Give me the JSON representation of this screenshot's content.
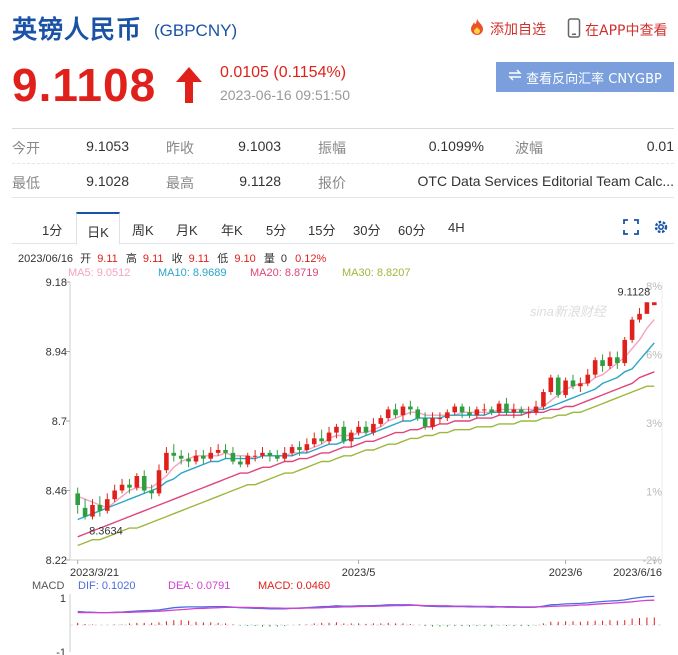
{
  "header": {
    "title": "英镑人民币",
    "code": "(GBPCNY)",
    "add_favorite": "添加自选",
    "view_in_app": "在APP中查看"
  },
  "quote": {
    "price": "9.1108",
    "change": "0.0105 (0.1154%)",
    "time": "2023-06-16 09:51:50",
    "reverse_button": "查看反向汇率 CNYGBP",
    "up_color": "#e0211b"
  },
  "stats": {
    "rows": [
      [
        {
          "label": "今开",
          "value": "9.1053"
        },
        {
          "label": "昨收",
          "value": "9.1003"
        },
        {
          "label": "振幅",
          "value": "0.1099%"
        },
        {
          "label": "波幅",
          "value": "0.01"
        }
      ],
      [
        {
          "label": "最低",
          "value": "9.1028"
        },
        {
          "label": "最高",
          "value": "9.1128"
        },
        {
          "label": "报价",
          "value": "OTC Data Services Editorial Team Calc..."
        }
      ]
    ]
  },
  "tabs": [
    "1分",
    "日K",
    "周K",
    "月K",
    "年K",
    "5分",
    "15分",
    "30分",
    "60分",
    "4H"
  ],
  "active_tab": "日K",
  "icons": [
    "fullscreen-icon",
    "settings-icon",
    "fire-icon",
    "phone-icon",
    "arrow-up-icon",
    "exchange-icon"
  ],
  "info_line": {
    "date": "2023/06/16",
    "open_label": "开",
    "open": "9.11",
    "high_label": "高",
    "high": "9.11",
    "close_label": "收",
    "close": "9.11",
    "low_label": "低",
    "low": "9.10",
    "vol_label": "量",
    "vol": "0",
    "pct": "0.12%"
  },
  "ma_legend": [
    {
      "text": "MA5: 9.0512",
      "color": "#f4a3c0"
    },
    {
      "text": "MA10: 8.9689",
      "color": "#2ba6c9"
    },
    {
      "text": "MA20: 8.8719",
      "color": "#e0447c"
    },
    {
      "text": "MA30: 8.8207",
      "color": "#9cb83c"
    }
  ],
  "macd_legend": {
    "label": "MACD",
    "dif": "DIF: 0.1020",
    "dea": "DEA: 0.0791",
    "macd": "MACD: 0.0460"
  },
  "watermark": "sina新浪财经",
  "chart_data": {
    "type": "candlestick",
    "y_ticks": [
      "9.18",
      "8.94",
      "8.7",
      "8.46",
      "8.22"
    ],
    "y_range": [
      8.22,
      9.18
    ],
    "pct_ticks": [
      "8%",
      "6%",
      "3%",
      "1%",
      "-2%"
    ],
    "x_ticks": [
      "2023/3/21",
      "2023/5",
      "2023/6",
      "2023/6/16"
    ],
    "max_label": "9.1128",
    "min_label": "8.3634",
    "macd_ticks": [
      "1",
      "-1"
    ],
    "candles": [
      [
        8.45,
        8.41,
        8.47,
        8.38
      ],
      [
        8.4,
        8.37,
        8.43,
        8.36
      ],
      [
        8.37,
        8.41,
        8.43,
        8.36
      ],
      [
        8.41,
        8.39,
        8.44,
        8.37
      ],
      [
        8.39,
        8.43,
        8.45,
        8.38
      ],
      [
        8.43,
        8.46,
        8.48,
        8.42
      ],
      [
        8.46,
        8.48,
        8.5,
        8.45
      ],
      [
        8.48,
        8.47,
        8.5,
        8.45
      ],
      [
        8.47,
        8.51,
        8.52,
        8.46
      ],
      [
        8.51,
        8.46,
        8.53,
        8.45
      ],
      [
        8.46,
        8.45,
        8.48,
        8.43
      ],
      [
        8.45,
        8.53,
        8.55,
        8.44
      ],
      [
        8.53,
        8.59,
        8.61,
        8.52
      ],
      [
        8.59,
        8.58,
        8.62,
        8.56
      ],
      [
        8.58,
        8.57,
        8.6,
        8.55
      ],
      [
        8.57,
        8.56,
        8.59,
        8.54
      ],
      [
        8.56,
        8.58,
        8.6,
        8.55
      ],
      [
        8.58,
        8.57,
        8.6,
        8.55
      ],
      [
        8.57,
        8.59,
        8.61,
        8.56
      ],
      [
        8.59,
        8.6,
        8.62,
        8.58
      ],
      [
        8.6,
        8.59,
        8.62,
        8.57
      ],
      [
        8.59,
        8.56,
        8.61,
        8.55
      ],
      [
        8.56,
        8.55,
        8.58,
        8.54
      ],
      [
        8.55,
        8.58,
        8.59,
        8.54
      ],
      [
        8.58,
        8.58,
        8.6,
        8.56
      ],
      [
        8.58,
        8.59,
        8.61,
        8.57
      ],
      [
        8.59,
        8.58,
        8.6,
        8.56
      ],
      [
        8.58,
        8.57,
        8.6,
        8.56
      ],
      [
        8.57,
        8.59,
        8.61,
        8.56
      ],
      [
        8.59,
        8.61,
        8.62,
        8.58
      ],
      [
        8.61,
        8.6,
        8.63,
        8.58
      ],
      [
        8.6,
        8.62,
        8.64,
        8.59
      ],
      [
        8.62,
        8.64,
        8.66,
        8.61
      ],
      [
        8.64,
        8.63,
        8.67,
        8.62
      ],
      [
        8.63,
        8.66,
        8.68,
        8.62
      ],
      [
        8.66,
        8.68,
        8.69,
        8.64
      ],
      [
        8.68,
        8.63,
        8.7,
        8.62
      ],
      [
        8.63,
        8.66,
        8.67,
        8.61
      ],
      [
        8.66,
        8.68,
        8.7,
        8.65
      ],
      [
        8.68,
        8.66,
        8.7,
        8.65
      ],
      [
        8.66,
        8.69,
        8.71,
        8.65
      ],
      [
        8.69,
        8.71,
        8.72,
        8.68
      ],
      [
        8.71,
        8.74,
        8.75,
        8.7
      ],
      [
        8.74,
        8.72,
        8.76,
        8.71
      ],
      [
        8.72,
        8.75,
        8.76,
        8.7
      ],
      [
        8.75,
        8.74,
        8.77,
        8.72
      ],
      [
        8.74,
        8.71,
        8.75,
        8.7
      ],
      [
        8.71,
        8.68,
        8.73,
        8.67
      ],
      [
        8.68,
        8.71,
        8.73,
        8.67
      ],
      [
        8.71,
        8.71,
        8.73,
        8.69
      ],
      [
        8.71,
        8.73,
        8.74,
        8.7
      ],
      [
        8.73,
        8.75,
        8.76,
        8.72
      ],
      [
        8.75,
        8.73,
        8.76,
        8.71
      ],
      [
        8.73,
        8.72,
        8.75,
        8.71
      ],
      [
        8.72,
        8.74,
        8.75,
        8.71
      ],
      [
        8.74,
        8.74,
        8.76,
        8.72
      ],
      [
        8.74,
        8.73,
        8.75,
        8.72
      ],
      [
        8.73,
        8.76,
        8.77,
        8.72
      ],
      [
        8.76,
        8.73,
        8.78,
        8.72
      ],
      [
        8.73,
        8.74,
        8.76,
        8.71
      ],
      [
        8.74,
        8.73,
        8.75,
        8.72
      ],
      [
        8.73,
        8.73,
        8.75,
        8.71
      ],
      [
        8.73,
        8.75,
        8.77,
        8.72
      ],
      [
        8.75,
        8.8,
        8.81,
        8.74
      ],
      [
        8.8,
        8.85,
        8.86,
        8.79
      ],
      [
        8.85,
        8.79,
        8.86,
        8.78
      ],
      [
        8.79,
        8.84,
        8.85,
        8.78
      ],
      [
        8.84,
        8.82,
        8.86,
        8.81
      ],
      [
        8.82,
        8.83,
        8.85,
        8.8
      ],
      [
        8.83,
        8.86,
        8.88,
        8.82
      ],
      [
        8.86,
        8.91,
        8.92,
        8.85
      ],
      [
        8.91,
        8.89,
        8.93,
        8.87
      ],
      [
        8.89,
        8.92,
        8.94,
        8.88
      ],
      [
        8.92,
        8.9,
        8.94,
        8.88
      ],
      [
        8.9,
        8.98,
        8.99,
        8.89
      ],
      [
        8.98,
        9.05,
        9.06,
        8.97
      ],
      [
        9.05,
        9.07,
        9.09,
        9.04
      ],
      [
        9.07,
        9.11,
        9.11,
        9.07
      ],
      [
        9.1,
        9.11,
        9.11,
        9.1
      ]
    ],
    "ma": [
      {
        "name": "MA5",
        "color": "#f4a3c0",
        "values": [
          8.44,
          8.43,
          8.42,
          8.41,
          8.4,
          8.42,
          8.44,
          8.46,
          8.47,
          8.47,
          8.47,
          8.49,
          8.51,
          8.54,
          8.56,
          8.57,
          8.58,
          8.58,
          8.58,
          8.58,
          8.59,
          8.58,
          8.58,
          8.58,
          8.57,
          8.58,
          8.58,
          8.58,
          8.58,
          8.59,
          8.59,
          8.6,
          8.61,
          8.62,
          8.64,
          8.65,
          8.65,
          8.65,
          8.66,
          8.66,
          8.67,
          8.68,
          8.7,
          8.71,
          8.72,
          8.73,
          8.73,
          8.72,
          8.72,
          8.72,
          8.72,
          8.72,
          8.73,
          8.73,
          8.73,
          8.73,
          8.73,
          8.74,
          8.74,
          8.74,
          8.74,
          8.74,
          8.74,
          8.75,
          8.77,
          8.79,
          8.81,
          8.82,
          8.83,
          8.83,
          8.85,
          8.86,
          8.88,
          8.9,
          8.92,
          8.95,
          8.98,
          9.02,
          9.05
        ]
      },
      {
        "name": "MA10",
        "color": "#2ba6c9",
        "values": [
          8.36,
          8.37,
          8.38,
          8.39,
          8.4,
          8.41,
          8.42,
          8.43,
          8.44,
          8.45,
          8.46,
          8.47,
          8.49,
          8.5,
          8.52,
          8.53,
          8.54,
          8.55,
          8.56,
          8.56,
          8.57,
          8.57,
          8.57,
          8.57,
          8.57,
          8.58,
          8.58,
          8.58,
          8.58,
          8.58,
          8.59,
          8.59,
          8.6,
          8.61,
          8.62,
          8.62,
          8.63,
          8.64,
          8.64,
          8.65,
          8.66,
          8.67,
          8.68,
          8.69,
          8.7,
          8.7,
          8.71,
          8.71,
          8.71,
          8.71,
          8.72,
          8.72,
          8.72,
          8.72,
          8.72,
          8.72,
          8.73,
          8.73,
          8.73,
          8.73,
          8.73,
          8.73,
          8.74,
          8.74,
          8.75,
          8.76,
          8.77,
          8.78,
          8.79,
          8.8,
          8.81,
          8.83,
          8.84,
          8.85,
          8.87,
          8.88,
          8.91,
          8.94,
          8.97
        ]
      },
      {
        "name": "MA20",
        "color": "#e0447c",
        "values": [
          8.3,
          8.31,
          8.32,
          8.33,
          8.34,
          8.35,
          8.36,
          8.37,
          8.38,
          8.39,
          8.4,
          8.41,
          8.42,
          8.43,
          8.44,
          8.45,
          8.46,
          8.47,
          8.48,
          8.49,
          8.5,
          8.51,
          8.52,
          8.52,
          8.53,
          8.54,
          8.54,
          8.55,
          8.56,
          8.56,
          8.57,
          8.57,
          8.58,
          8.59,
          8.59,
          8.6,
          8.61,
          8.61,
          8.62,
          8.63,
          8.63,
          8.64,
          8.65,
          8.66,
          8.66,
          8.67,
          8.67,
          8.68,
          8.68,
          8.69,
          8.69,
          8.7,
          8.7,
          8.7,
          8.71,
          8.71,
          8.71,
          8.72,
          8.72,
          8.72,
          8.72,
          8.73,
          8.73,
          8.73,
          8.74,
          8.74,
          8.75,
          8.75,
          8.76,
          8.77,
          8.78,
          8.79,
          8.8,
          8.81,
          8.82,
          8.83,
          8.85,
          8.86,
          8.87
        ]
      },
      {
        "name": "MA30",
        "color": "#9cb83c",
        "values": [
          8.27,
          8.28,
          8.29,
          8.29,
          8.3,
          8.31,
          8.32,
          8.33,
          8.33,
          8.34,
          8.35,
          8.36,
          8.37,
          8.38,
          8.39,
          8.4,
          8.41,
          8.42,
          8.43,
          8.44,
          8.45,
          8.46,
          8.47,
          8.48,
          8.48,
          8.49,
          8.5,
          8.51,
          8.52,
          8.52,
          8.53,
          8.54,
          8.55,
          8.56,
          8.56,
          8.57,
          8.58,
          8.58,
          8.59,
          8.6,
          8.6,
          8.61,
          8.62,
          8.62,
          8.63,
          8.64,
          8.64,
          8.65,
          8.65,
          8.66,
          8.66,
          8.67,
          8.67,
          8.67,
          8.68,
          8.68,
          8.68,
          8.69,
          8.69,
          8.69,
          8.7,
          8.7,
          8.7,
          8.71,
          8.71,
          8.72,
          8.72,
          8.73,
          8.73,
          8.74,
          8.75,
          8.76,
          8.77,
          8.78,
          8.79,
          8.8,
          8.81,
          8.82,
          8.82
        ]
      }
    ],
    "macd_range": [
      -1,
      1
    ],
    "dif": [
      0.5,
      0.48,
      0.47,
      0.46,
      0.46,
      0.47,
      0.48,
      0.5,
      0.52,
      0.53,
      0.54,
      0.56,
      0.6,
      0.64,
      0.66,
      0.67,
      0.67,
      0.67,
      0.68,
      0.68,
      0.68,
      0.66,
      0.64,
      0.63,
      0.62,
      0.61,
      0.6,
      0.6,
      0.6,
      0.62,
      0.63,
      0.64,
      0.66,
      0.68,
      0.69,
      0.71,
      0.7,
      0.7,
      0.71,
      0.71,
      0.72,
      0.73,
      0.75,
      0.75,
      0.75,
      0.75,
      0.73,
      0.7,
      0.69,
      0.68,
      0.68,
      0.68,
      0.68,
      0.67,
      0.67,
      0.67,
      0.66,
      0.67,
      0.66,
      0.66,
      0.65,
      0.65,
      0.66,
      0.7,
      0.75,
      0.76,
      0.78,
      0.79,
      0.8,
      0.82,
      0.85,
      0.87,
      0.89,
      0.9,
      0.93,
      0.98,
      1.02,
      1.05,
      1.06
    ],
    "dea": [
      0.46,
      0.46,
      0.46,
      0.46,
      0.46,
      0.46,
      0.47,
      0.47,
      0.48,
      0.49,
      0.5,
      0.51,
      0.53,
      0.55,
      0.57,
      0.59,
      0.61,
      0.62,
      0.63,
      0.64,
      0.65,
      0.65,
      0.65,
      0.65,
      0.64,
      0.64,
      0.63,
      0.63,
      0.62,
      0.62,
      0.62,
      0.63,
      0.63,
      0.64,
      0.65,
      0.66,
      0.67,
      0.67,
      0.68,
      0.69,
      0.69,
      0.7,
      0.71,
      0.72,
      0.72,
      0.73,
      0.73,
      0.72,
      0.72,
      0.71,
      0.71,
      0.7,
      0.7,
      0.7,
      0.69,
      0.69,
      0.69,
      0.68,
      0.68,
      0.68,
      0.67,
      0.67,
      0.67,
      0.67,
      0.69,
      0.7,
      0.71,
      0.72,
      0.74,
      0.75,
      0.77,
      0.79,
      0.8,
      0.82,
      0.84,
      0.86,
      0.89,
      0.91,
      0.92
    ]
  }
}
